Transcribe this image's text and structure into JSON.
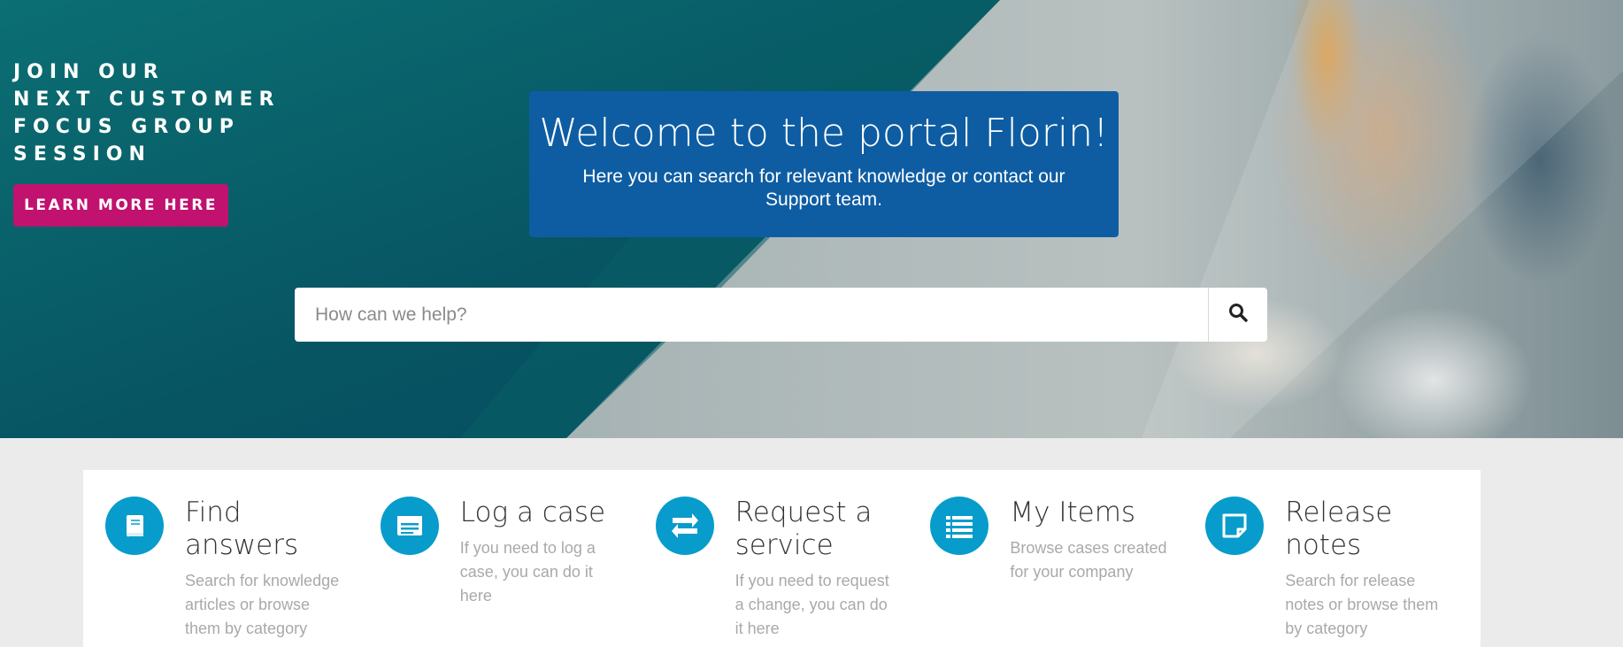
{
  "promo": {
    "lines": [
      "JOIN OUR",
      "NEXT CUSTOMER",
      "FOCUS GROUP",
      "SESSION"
    ],
    "button_label": "LEARN MORE HERE",
    "button_color": "#c0126e"
  },
  "welcome": {
    "title": "Welcome to the portal Florin!",
    "subtitle": "Here you can search for relevant knowledge or contact our Support team.",
    "background_color": "#0e5da3"
  },
  "search": {
    "placeholder": "How can we help?",
    "icon": "search-icon"
  },
  "cards": [
    {
      "icon": "book-icon",
      "title": "Find answers",
      "description": "Search for knowledge articles or browse them by category"
    },
    {
      "icon": "form-icon",
      "title": "Log a case",
      "description": "If you need to log a case, you can do it here"
    },
    {
      "icon": "exchange-icon",
      "title": "Request a service",
      "description": "If you need to request a change, you can do it here"
    },
    {
      "icon": "list-icon",
      "title": "My Items",
      "description": "Browse cases created for your company"
    },
    {
      "icon": "note-icon",
      "title": "Release notes",
      "description": "Search for release notes or browse them by category"
    }
  ],
  "colors": {
    "accent": "#079ccb",
    "page_background": "#ebebeb"
  }
}
